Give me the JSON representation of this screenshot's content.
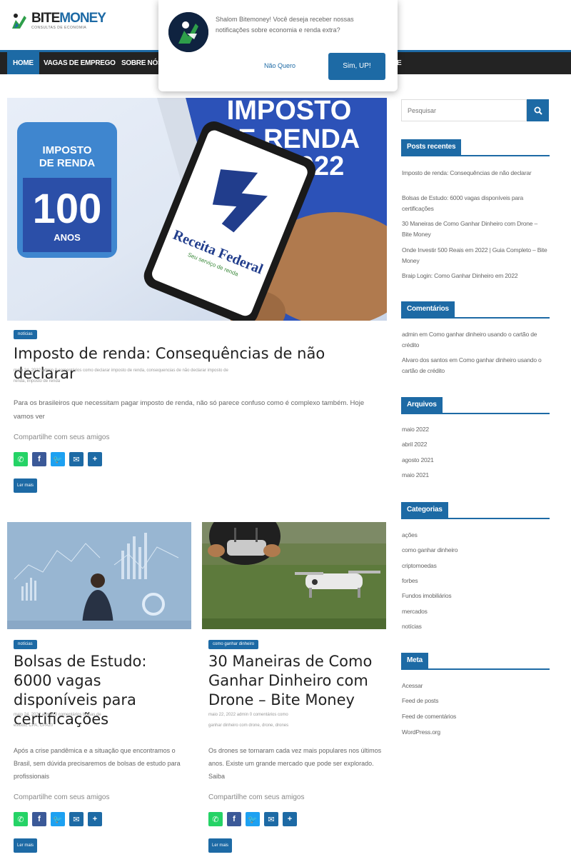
{
  "site": {
    "logo_part1": "BITE",
    "logo_part2": "MONEY",
    "tagline": "CONSULTAS DE ECONOMIA"
  },
  "nav": {
    "items": [
      {
        "label": "HOME",
        "active": true
      },
      {
        "label": "VAGAS DE EMPREGO",
        "active": false
      },
      {
        "label": "SOBRE NÓS",
        "active": false
      }
    ],
    "overflow_label": "E"
  },
  "popup": {
    "message": "Shalom Bitemoney! Você deseja receber nossas notificações sobre economia e renda extra?",
    "decline_label": "Não Quero",
    "accept_label": "Sim, UP!"
  },
  "hero_image": {
    "badge_line1": "IMPOSTO",
    "badge_line2": "DE RENDA",
    "badge_number": "100",
    "badge_anos": "ANOS",
    "banner_line1": "IMPOSTO",
    "banner_line2": "DE RENDA",
    "banner_year": "2022",
    "phone_text": "Receita Federal",
    "phone_subtext": "Seu serviço de renda"
  },
  "articles": [
    {
      "category": "notícias",
      "title": "Imposto de renda: Consequências de não declarar",
      "meta_line1": "maio 24, 2022     admin     0 comentários     como declarar imposto de renda, consequencias de não declarar imposto de",
      "meta_line2": "renda, imposto de renda",
      "excerpt": "Para os brasileiros que necessitam pagar imposto de renda, não só parece confuso como é complexo também. Hoje vamos ver",
      "share_label": "Compartilhe com seus amigos",
      "read_more": "Ler mais"
    },
    {
      "category": "notícias",
      "title": "Bolsas de Estudo: 6000 vagas disponíveis para certificações",
      "meta_line1": "maio 24, 2022     admin     0 comentários     bolsas de",
      "meta_line2": "estudo, CPA, CPA20",
      "excerpt": "Após a crise pandêmica e a situação que encontramos o Brasil, sem dúvida precisaremos de bolsas de estudo para profissionais",
      "share_label": "Compartilhe com seus amigos",
      "read_more": "Ler mais"
    },
    {
      "category": "como ganhar dinheiro",
      "title": "30 Maneiras de Como Ganhar Dinheiro com Drone – Bite Money",
      "meta_line1": "maio 22, 2022     admin     0 comentários     como",
      "meta_line2": "ganhar dinheiro com drone, drone, drones",
      "excerpt": "Os drones se tornaram cada vez mais populares nos últimos anos. Existe um grande mercado que pode ser explorado. Saiba",
      "share_label": "Compartilhe com seus amigos",
      "read_more": "Ler mais"
    }
  ],
  "sidebar": {
    "search_placeholder": "Pesquisar",
    "recent_title": "Posts recentes",
    "recent_posts": [
      "Imposto de renda: Consequências de não declarar",
      "Bolsas de Estudo: 6000 vagas disponíveis para certificações",
      "30 Maneiras de Como Ganhar Dinheiro com Drone – Bite Money",
      "Onde Investir 500 Reais em 2022 | Guia Completo – Bite Money",
      "Braip Login: Como Ganhar Dinheiro em 2022"
    ],
    "comments_title": "Comentários",
    "comments": [
      "admin em Como ganhar dinheiro usando o cartão de crédito",
      "Alvaro dos santos em Como ganhar dinheiro usando o cartão de crédito"
    ],
    "archives_title": "Arquivos",
    "archives": [
      "maio 2022",
      "abril 2022",
      "agosto 2021",
      "maio 2021"
    ],
    "categories_title": "Categorias",
    "categories": [
      "ações",
      "como ganhar dinheiro",
      "criptomoedas",
      "forbes",
      "Fundos imobiliários",
      "mercados",
      "notícias"
    ],
    "meta_title": "Meta",
    "meta_links": [
      "Acessar",
      "Feed de posts",
      "Feed de comentários",
      "WordPress.org"
    ]
  },
  "colors": {
    "accent": "#1d6aa5",
    "nav_bg": "#232323",
    "whatsapp": "#25d366",
    "facebook": "#3b5998",
    "twitter": "#1da1f2",
    "email": "#1d6aa5",
    "more": "#1d6aa5"
  }
}
